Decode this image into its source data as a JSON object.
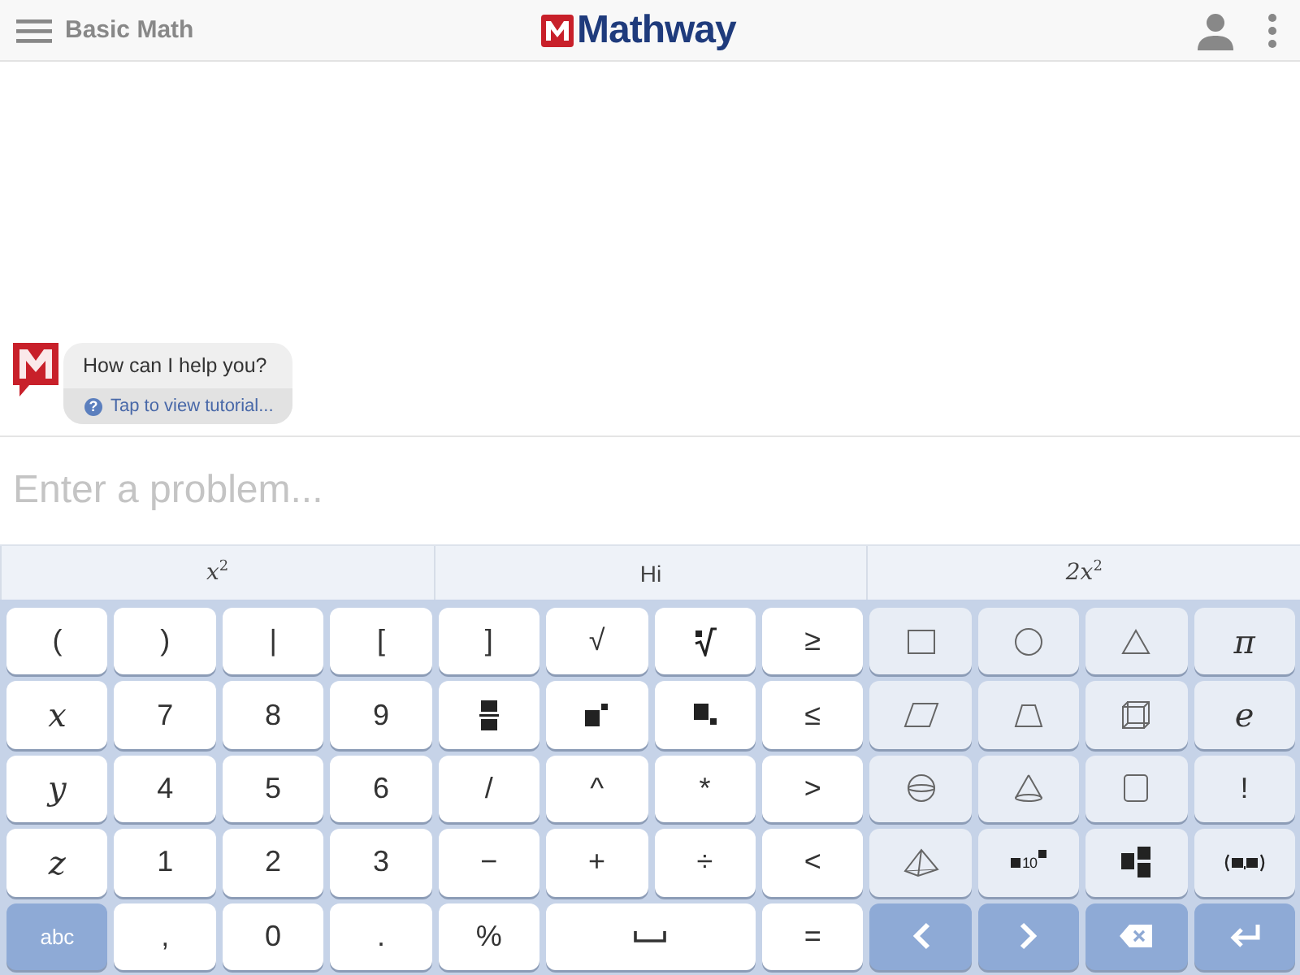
{
  "header": {
    "menu_label": "Basic Math",
    "logo": "Mathway"
  },
  "chat": {
    "message": "How can I help you?",
    "help_mark": "?",
    "tutorial_link": "Tap to view tutorial..."
  },
  "input": {
    "placeholder": "Enter a problem..."
  },
  "suggestions": [
    {
      "kind": "math",
      "label": "x$^{2}$"
    },
    {
      "kind": "text",
      "label": "Hi"
    },
    {
      "kind": "math",
      "label": "2x$^{2}$"
    }
  ],
  "keyboard": [
    [
      {
        "kind": "char",
        "color": "#ffffff",
        "label": "("
      },
      {
        "kind": "char",
        "color": "#ffffff",
        "label": ")"
      },
      {
        "kind": "char",
        "color": "#ffffff",
        "label": "|"
      },
      {
        "kind": "char",
        "color": "#ffffff",
        "label": "["
      },
      {
        "kind": "char",
        "color": "#ffffff",
        "label": "]"
      },
      {
        "kind": "char",
        "color": "#ffffff",
        "label": "√"
      },
      {
        "kind": "nroot",
        "color": "#ffffff"
      },
      {
        "kind": "char",
        "color": "#ffffff",
        "label": "≥"
      },
      {
        "kind": "square",
        "color": "#e8edf5"
      },
      {
        "kind": "circle",
        "color": "#e8edf5"
      },
      {
        "kind": "triangle",
        "color": "#e8edf5"
      },
      {
        "kind": "var",
        "color": "#e8edf5",
        "label": "π"
      }
    ],
    [
      {
        "kind": "var",
        "color": "#ffffff",
        "label": "x"
      },
      {
        "kind": "char",
        "color": "#ffffff",
        "label": "7"
      },
      {
        "kind": "char",
        "color": "#ffffff",
        "label": "8"
      },
      {
        "kind": "char",
        "color": "#ffffff",
        "label": "9"
      },
      {
        "kind": "fraction",
        "color": "#ffffff"
      },
      {
        "kind": "power",
        "color": "#ffffff"
      },
      {
        "kind": "subscript",
        "color": "#ffffff"
      },
      {
        "kind": "char",
        "color": "#ffffff",
        "label": "≤"
      },
      {
        "kind": "parallelogram",
        "color": "#e8edf5"
      },
      {
        "kind": "trapezoid",
        "color": "#e8edf5"
      },
      {
        "kind": "cube",
        "color": "#e8edf5"
      },
      {
        "kind": "var",
        "color": "#e8edf5",
        "label": "e"
      }
    ],
    [
      {
        "kind": "var",
        "color": "#ffffff",
        "label": "y"
      },
      {
        "kind": "char",
        "color": "#ffffff",
        "label": "4"
      },
      {
        "kind": "char",
        "color": "#ffffff",
        "label": "5"
      },
      {
        "kind": "char",
        "color": "#ffffff",
        "label": "6"
      },
      {
        "kind": "char",
        "color": "#ffffff",
        "label": "/"
      },
      {
        "kind": "char",
        "color": "#ffffff",
        "label": "^"
      },
      {
        "kind": "char",
        "color": "#ffffff",
        "label": "*"
      },
      {
        "kind": "char",
        "color": "#ffffff",
        "label": ">"
      },
      {
        "kind": "sphere",
        "color": "#e8edf5"
      },
      {
        "kind": "cone",
        "color": "#e8edf5"
      },
      {
        "kind": "cylinder",
        "color": "#e8edf5"
      },
      {
        "kind": "char",
        "color": "#e8edf5",
        "label": "!"
      }
    ],
    [
      {
        "kind": "var",
        "color": "#ffffff",
        "label": "z"
      },
      {
        "kind": "char",
        "color": "#ffffff",
        "label": "1"
      },
      {
        "kind": "char",
        "color": "#ffffff",
        "label": "2"
      },
      {
        "kind": "char",
        "color": "#ffffff",
        "label": "3"
      },
      {
        "kind": "char",
        "color": "#ffffff",
        "label": "−"
      },
      {
        "kind": "char",
        "color": "#ffffff",
        "label": "+"
      },
      {
        "kind": "char",
        "color": "#ffffff",
        "label": "÷"
      },
      {
        "kind": "char",
        "color": "#ffffff",
        "label": "<"
      },
      {
        "kind": "pyramid",
        "color": "#e8edf5"
      },
      {
        "kind": "scinot",
        "color": "#e8edf5",
        "label": "10"
      },
      {
        "kind": "matrix",
        "color": "#e8edf5"
      },
      {
        "kind": "vector",
        "color": "#e8edf5"
      }
    ],
    [
      {
        "kind": "char",
        "color": "#8eaad6",
        "label": "abc"
      },
      {
        "kind": "char",
        "color": "#ffffff",
        "label": ","
      },
      {
        "kind": "char",
        "color": "#ffffff",
        "label": "0"
      },
      {
        "kind": "char",
        "color": "#ffffff",
        "label": "."
      },
      {
        "kind": "char",
        "color": "#ffffff",
        "label": "%"
      },
      {
        "kind": "space",
        "color": "#ffffff"
      },
      {
        "kind": "char",
        "color": "#ffffff",
        "label": "="
      },
      {
        "kind": "left",
        "color": "#8eaad6"
      },
      {
        "kind": "right",
        "color": "#8eaad6"
      },
      {
        "kind": "backspace",
        "color": "#8eaad6"
      },
      {
        "kind": "enter",
        "color": "#8eaad6"
      }
    ]
  ]
}
